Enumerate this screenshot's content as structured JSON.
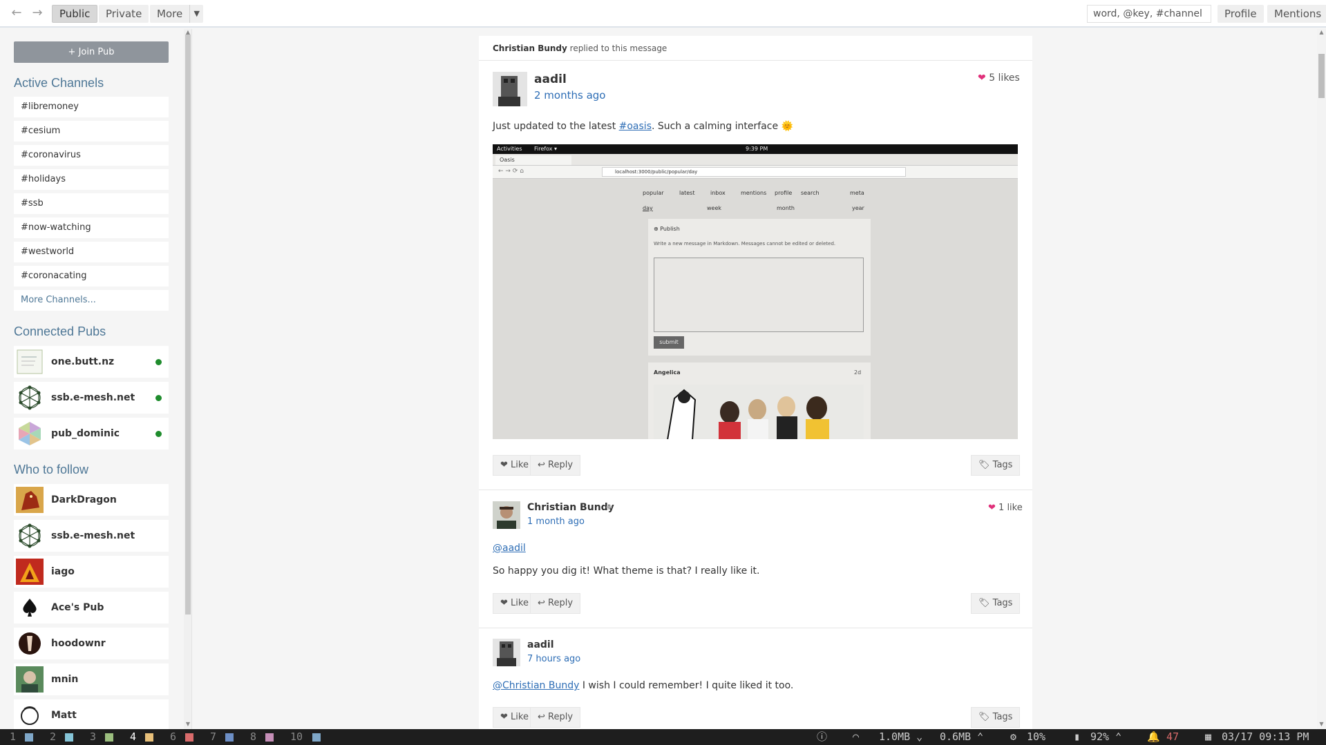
{
  "nav": {
    "public": "Public",
    "private": "Private",
    "more": "More",
    "search_placeholder": "word, @key, #channel",
    "profile": "Profile",
    "mentions": "Mentions"
  },
  "sidebar": {
    "join_pub": "+ Join Pub",
    "active_channels_heading": "Active Channels",
    "channels": [
      "#libremoney",
      "#cesium",
      "#coronavirus",
      "#holidays",
      "#ssb",
      "#now-watching",
      "#westworld",
      "#coronacating"
    ],
    "more_channels": "More Channels...",
    "connected_pubs_heading": "Connected Pubs",
    "pubs": [
      "one.butt.nz",
      "ssb.e-mesh.net",
      "pub_dominic"
    ],
    "who_to_follow_heading": "Who to follow",
    "follow": [
      "DarkDragon",
      "ssb.e-mesh.net",
      "iago",
      "Ace's Pub",
      "hoodownr",
      "mnin",
      "Matt"
    ]
  },
  "feed": {
    "reply_banner_name": "Christian Bundy",
    "reply_banner_text": " replied to this message",
    "post": {
      "author": "aadil",
      "time": "2 months ago",
      "likes": "5 likes",
      "text_before": "Just updated to the latest ",
      "tag": "#oasis",
      "text_after": ". Such a calming interface 🌞"
    },
    "embed": {
      "activities": "Activities",
      "firefox": "Firefox ▾",
      "clock": "9:39 PM",
      "tab": "Oasis",
      "url": "localhost:3000/public/popular/day",
      "nav": [
        "popular",
        "latest",
        "inbox",
        "mentions",
        "profile",
        "search",
        "meta"
      ],
      "periods": [
        "day",
        "week",
        "month",
        "year"
      ],
      "publish": "Publish",
      "hint": "Write a new message in Markdown. Messages cannot be edited or deleted.",
      "submit": "submit",
      "card_author": "Angelica",
      "card_age": "2d"
    },
    "reply1": {
      "author": "Christian Bundy",
      "time": "1 month ago",
      "likes": "1 like",
      "mention": "@aadil",
      "text": "So happy you dig it! What theme is that? I really like it."
    },
    "reply2": {
      "author": "aadil",
      "time": "7 hours ago",
      "mention": "@Christian Bundy",
      "text": " I wish I could remember! I quite liked it too."
    },
    "actions": {
      "like": "❤ Like",
      "reply": "↩ Reply",
      "tags": "Tags"
    }
  },
  "panel": {
    "workspaces": [
      "1",
      "2",
      "3",
      "4",
      "6",
      "7",
      "8",
      "10"
    ],
    "net_down": "1.0MB",
    "net_up": "0.6MB",
    "cpu": "10%",
    "battery": "92%",
    "notifications": "47",
    "datetime": "03/17 09:13 PM"
  },
  "colors": {
    "link": "#2d6db5",
    "heading": "#4e7796",
    "heart": "#e0307a",
    "online": "#1f8c2d"
  }
}
